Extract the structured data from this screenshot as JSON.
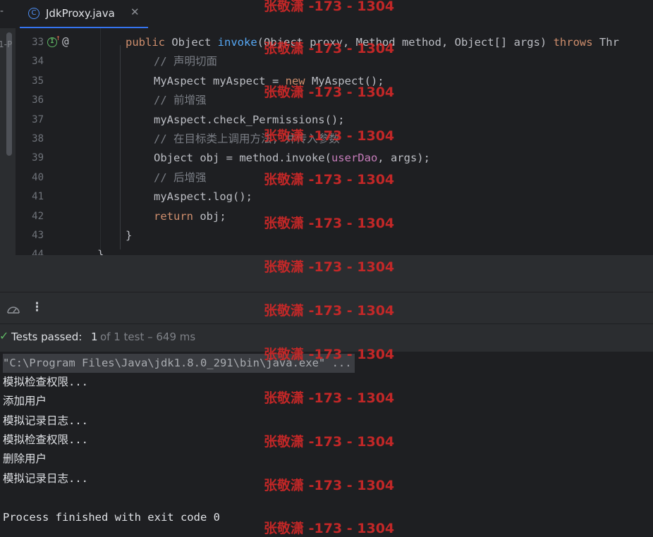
{
  "tab": {
    "label": "JdkProxy.java",
    "close": "✕",
    "icon_letter": "C"
  },
  "left_strip": {
    "text": "1-P"
  },
  "editor": {
    "lines": [
      {
        "n": "33",
        "parts": [
          {
            "t": "public ",
            "c": "kw"
          },
          {
            "t": "Object ",
            "c": ""
          },
          {
            "t": "invoke",
            "c": "fn"
          },
          {
            "t": "(Object proxy, Method method, Object[] args) ",
            "c": ""
          },
          {
            "t": "throws ",
            "c": "kw"
          },
          {
            "t": "Thr",
            "c": ""
          }
        ]
      },
      {
        "n": "34",
        "parts": [
          {
            "t": "// 声明切面",
            "c": "cm"
          }
        ]
      },
      {
        "n": "35",
        "parts": [
          {
            "t": "MyAspect myAspect = ",
            "c": ""
          },
          {
            "t": "new ",
            "c": "kw"
          },
          {
            "t": "MyAspect();",
            "c": ""
          }
        ]
      },
      {
        "n": "36",
        "parts": [
          {
            "t": "// 前增强",
            "c": "cm"
          }
        ]
      },
      {
        "n": "37",
        "parts": [
          {
            "t": "myAspect.check_Permissions();",
            "c": ""
          }
        ]
      },
      {
        "n": "38",
        "parts": [
          {
            "t": "// 在目标类上调用方法, 并传入参数",
            "c": "cm"
          }
        ]
      },
      {
        "n": "39",
        "parts": [
          {
            "t": "Object obj = method.invoke(",
            "c": ""
          },
          {
            "t": "userDao",
            "c": "fld"
          },
          {
            "t": ", args);",
            "c": ""
          }
        ]
      },
      {
        "n": "40",
        "parts": [
          {
            "t": "// 后增强",
            "c": "cm"
          }
        ]
      },
      {
        "n": "41",
        "parts": [
          {
            "t": "myAspect.log();",
            "c": ""
          }
        ]
      },
      {
        "n": "42",
        "parts": [
          {
            "t": "return ",
            "c": "kw"
          },
          {
            "t": "obj;",
            "c": ""
          }
        ]
      },
      {
        "n": "43",
        "parts": [
          {
            "t": "}",
            "c": ""
          }
        ]
      },
      {
        "n": "44",
        "parts": [
          {
            "t": "}",
            "c": ""
          }
        ]
      }
    ],
    "indent": [
      "1",
      "2",
      "2",
      "2",
      "2",
      "2",
      "2",
      "2",
      "2",
      "2",
      "1",
      "0"
    ],
    "gutter_at": "@"
  },
  "toolbar": {
    "more": "⋮"
  },
  "status": {
    "main": "Tests passed: ",
    "count": "1",
    "rest": " of 1 test – 649 ms"
  },
  "console": {
    "cmd": "\"C:\\Program Files\\Java\\jdk1.8.0_291\\bin\\java.exe\" ...",
    "lines": [
      "模拟检查权限...",
      "添加用户",
      "模拟记录日志...",
      "模拟检查权限...",
      "删除用户",
      "模拟记录日志...",
      "",
      "Process finished with exit code 0"
    ]
  },
  "watermark": "张敬潇 -173 - 1304",
  "colors": {
    "keyword": "#cf8e6d",
    "function": "#56a8f5",
    "comment": "#7a7e85",
    "field": "#c77dbb",
    "pass": "#5fb865",
    "accent": "#3574f0"
  }
}
